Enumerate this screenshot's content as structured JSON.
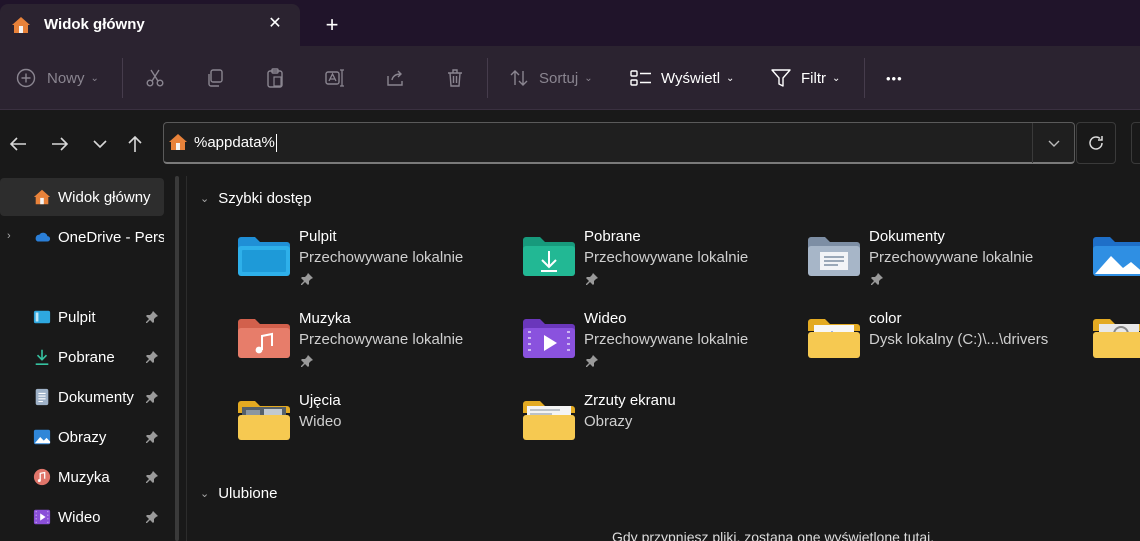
{
  "window": {
    "tab_title": "Widok główny",
    "close_glyph": "✕",
    "new_tab_glyph": "+"
  },
  "toolbar": {
    "new_label": "Nowy",
    "sort_label": "Sortuj",
    "view_label": "Wyświetl",
    "filter_label": "Filtr",
    "more_glyph": "•••"
  },
  "address": {
    "value": "%appdata%"
  },
  "sidebar": {
    "items": [
      {
        "label": "Widok główny",
        "icon": "home-icon"
      },
      {
        "label": "OneDrive - Personal",
        "icon": "onedrive-icon"
      },
      {
        "label": "Pulpit",
        "icon": "desktop-icon"
      },
      {
        "label": "Pobrane",
        "icon": "download-icon"
      },
      {
        "label": "Dokumenty",
        "icon": "documents-icon"
      },
      {
        "label": "Obrazy",
        "icon": "pictures-icon"
      },
      {
        "label": "Muzyka",
        "icon": "music-icon"
      },
      {
        "label": "Wideo",
        "icon": "video-icon"
      }
    ]
  },
  "main": {
    "quick_access_title": "Szybki dostęp",
    "favorites_title": "Ulubione",
    "favorites_empty": "Gdy przypniesz pliki, zostaną one wyświetlone tutaj.",
    "tiles": [
      {
        "name": "Pulpit",
        "sub": "Przechowywane lokalnie",
        "pinned": true
      },
      {
        "name": "Pobrane",
        "sub": "Przechowywane lokalnie",
        "pinned": true
      },
      {
        "name": "Dokumenty",
        "sub": "Przechowywane lokalnie",
        "pinned": true
      },
      {
        "name": "Muzyka",
        "sub": "Przechowywane lokalnie",
        "pinned": true
      },
      {
        "name": "Wideo",
        "sub": "Przechowywane lokalnie",
        "pinned": true
      },
      {
        "name": "color",
        "sub": "Dysk lokalny (C:)\\...\\drivers",
        "pinned": false
      },
      {
        "name": "Ujęcia",
        "sub": "Wideo",
        "pinned": false
      },
      {
        "name": "Zrzuty ekranu",
        "sub": "Obrazy",
        "pinned": false
      }
    ]
  },
  "colors": {
    "accent_folder": "#f5c64a",
    "titlebar": "#20142a",
    "toolbar": "#2b2330"
  }
}
